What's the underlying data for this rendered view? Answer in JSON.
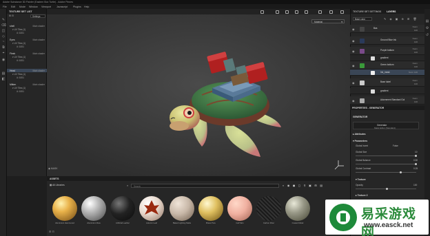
{
  "window": {
    "title": "Adobe Substance 3D Painter (Eastern Box Turtle) - Adobe Pinnes"
  },
  "menu": [
    "File",
    "Edit",
    "Mode",
    "Window",
    "Viewport",
    "Javascript",
    "Plugins",
    "Help"
  ],
  "texture_set_list": {
    "title": "TEXTURE SET LIST",
    "settings_label": "Settings",
    "sets": [
      {
        "name": "shell",
        "shader": "Main shader",
        "uv": "UV Tiles (1)",
        "tile": "1001"
      },
      {
        "name": "Eyes",
        "shader": "Main shader",
        "uv": "UV Tiles (1)",
        "tile": "1001"
      },
      {
        "name": "Flesh",
        "shader": "Main shader",
        "uv": "UV Tiles (1)",
        "tile": "1001"
      },
      {
        "name": "Head",
        "shader": "Main shader",
        "uv": "UV Tiles (1)",
        "tile": "1001"
      },
      {
        "name": "Mitten",
        "shader": "Main shader",
        "uv": "UV Tiles (1)",
        "tile": "1001"
      }
    ]
  },
  "viewport": {
    "mode": "Material",
    "mask_label": "MASK"
  },
  "layers_panel": {
    "tabs": [
      "TEXTURE SET SETTINGS",
      "LAYERS"
    ],
    "channel": "Base color",
    "rows": [
      {
        "name": "Bas",
        "blend": "Norm",
        "opacity": "100"
      },
      {
        "name": "Ground Blue Ink",
        "blend": "Norm",
        "opacity": "100"
      },
      {
        "name": "Purple bottom",
        "blend": "Norm",
        "opacity": "100"
      },
      {
        "name": "gradient",
        "blend": "",
        "opacity": ""
      },
      {
        "name": "Green bottom",
        "blend": "Norm",
        "opacity": "100"
      },
      {
        "name": "Ink_mask",
        "blend": "",
        "opacity": "Norm 100"
      },
      {
        "name": "Base label",
        "blend": "Norm",
        "opacity": "100"
      },
      {
        "name": "gradient",
        "blend": "",
        "opacity": ""
      },
      {
        "name": "Adornment Standard Gol",
        "blend": "Norm",
        "opacity": "100"
      }
    ]
  },
  "properties": {
    "header": "PROPERTIES - GENERATOR",
    "section": "GENERATOR",
    "generator_name": "Generator",
    "generator_sub": "Mask Editor (Standard)",
    "attributes": "Attributes",
    "parameters": "Parameters",
    "params": [
      {
        "label": "Global Invert",
        "value": "False"
      },
      {
        "label": "Global Size",
        "value": "10"
      },
      {
        "label": "Global Balance",
        "value": "0.50"
      },
      {
        "label": "Global Contrast",
        "value": "0.25"
      }
    ],
    "texture_section": "Texture",
    "opacity_label": "Opacity",
    "opacity_value": "100",
    "texture2": "Texture 2"
  },
  "assets": {
    "title": "ASSETS",
    "filter": "All Libraries",
    "search_placeholder": "Search",
    "materials": [
      {
        "label": "Aluminium Hammered",
        "color1": "#e9b24a",
        "color2": "#6e4713"
      },
      {
        "label": "Aluminium Raw",
        "color1": "#eeeeee",
        "color2": "#444444"
      },
      {
        "label": "Artificial Leather",
        "color1": "#555555",
        "color2": "#0b0b0b"
      },
      {
        "label": "Autumn Leaf",
        "color1": "#f0e6dc",
        "color2": "#8a2a10"
      },
      {
        "label": "Baked Lighting Matte",
        "color1": "#d8c8b8",
        "color2": "#6b5a4a"
      },
      {
        "label": "Brass Pure",
        "color1": "#f4e088",
        "color2": "#6a4e10"
      },
      {
        "label": "Calf Skin",
        "color1": "#f0b8a0",
        "color2": "#a06050"
      },
      {
        "label": "Carbon Fiber",
        "color1": "#888888",
        "color2": "#111111"
      },
      {
        "label": "Coated Metal",
        "color1": "#bbbbaa",
        "color2": "#444433"
      }
    ]
  },
  "watermark": {
    "title": "易采游戏网",
    "url": "www.easck.net"
  }
}
